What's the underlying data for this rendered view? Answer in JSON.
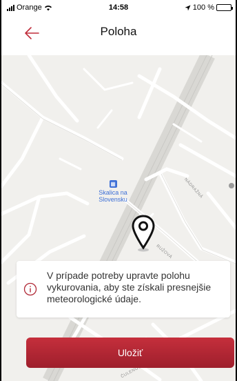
{
  "status_bar": {
    "carrier": "Orange",
    "time": "14:58",
    "battery": "100 %"
  },
  "header": {
    "title": "Poloha"
  },
  "map": {
    "station_label": "Skalica na Slovensku",
    "street_1": "NÁDRAŽNÁ",
    "street_2": "RUŽOVÁ",
    "street_3": "ČULENOVA"
  },
  "info_card": {
    "message": "V prípade potreby upravte polohu vykurovania, aby ste získali presnejšie meteorologické údaje."
  },
  "actions": {
    "save_label": "Uložiť"
  },
  "colors": {
    "accent": "#b02836",
    "map_background": "#f1f0ed",
    "road": "#ffffff"
  }
}
